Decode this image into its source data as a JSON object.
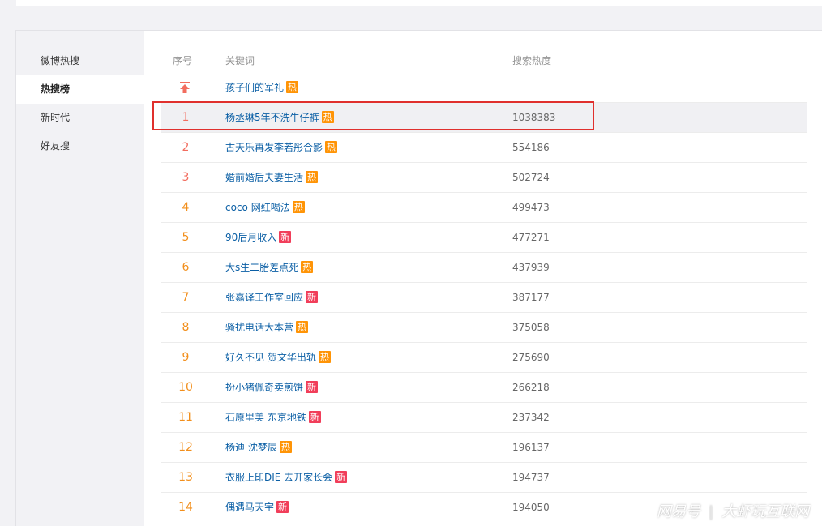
{
  "sidebar": {
    "items": [
      {
        "label": "微博热搜",
        "active": false
      },
      {
        "label": "热搜榜",
        "active": true
      },
      {
        "label": "新时代",
        "active": false
      },
      {
        "label": "好友搜",
        "active": false
      }
    ]
  },
  "table": {
    "headers": {
      "rank": "序号",
      "keyword": "关键词",
      "heat": "搜索热度"
    },
    "pinned": {
      "keyword": "孩子们的军礼",
      "tag": "热",
      "tag_type": "hot",
      "icon": "pin-top-icon"
    },
    "rows": [
      {
        "rank": "1",
        "keyword": "杨丞琳5年不洗牛仔裤",
        "tag": "热",
        "tag_type": "hot",
        "heat": "1038383"
      },
      {
        "rank": "2",
        "keyword": "古天乐再发李若彤合影",
        "tag": "热",
        "tag_type": "hot",
        "heat": "554186"
      },
      {
        "rank": "3",
        "keyword": "婚前婚后夫妻生活",
        "tag": "热",
        "tag_type": "hot",
        "heat": "502724"
      },
      {
        "rank": "4",
        "keyword": "coco 网红喝法",
        "tag": "热",
        "tag_type": "hot",
        "heat": "499473"
      },
      {
        "rank": "5",
        "keyword": "90后月收入",
        "tag": "新",
        "tag_type": "new",
        "heat": "477271"
      },
      {
        "rank": "6",
        "keyword": "大s生二胎差点死",
        "tag": "热",
        "tag_type": "hot",
        "heat": "437939"
      },
      {
        "rank": "7",
        "keyword": "张嘉译工作室回应",
        "tag": "新",
        "tag_type": "new",
        "heat": "387177"
      },
      {
        "rank": "8",
        "keyword": "骚扰电话大本营",
        "tag": "热",
        "tag_type": "hot",
        "heat": "375058"
      },
      {
        "rank": "9",
        "keyword": "好久不见 贺文华出轨",
        "tag": "热",
        "tag_type": "hot",
        "heat": "275690"
      },
      {
        "rank": "10",
        "keyword": "扮小猪佩奇卖煎饼",
        "tag": "新",
        "tag_type": "new",
        "heat": "266218"
      },
      {
        "rank": "11",
        "keyword": "石原里美 东京地铁",
        "tag": "新",
        "tag_type": "new",
        "heat": "237342"
      },
      {
        "rank": "12",
        "keyword": "杨迪 沈梦辰",
        "tag": "热",
        "tag_type": "hot",
        "heat": "196137"
      },
      {
        "rank": "13",
        "keyword": "衣服上印DIE 去开家长会",
        "tag": "新",
        "tag_type": "new",
        "heat": "194737"
      },
      {
        "rank": "14",
        "keyword": "偶遇马天宇",
        "tag": "新",
        "tag_type": "new",
        "heat": "194050"
      }
    ]
  },
  "colors": {
    "top3_rank": "#f26d5f",
    "rank": "#f28f1c",
    "link": "#0b5fa5",
    "hot_tag": "#ff9406",
    "new_tag": "#f13e5a",
    "highlight_box": "#e0302d"
  },
  "watermark": {
    "left": "网易号",
    "separator": "|",
    "right": "大虾玩互联网"
  }
}
